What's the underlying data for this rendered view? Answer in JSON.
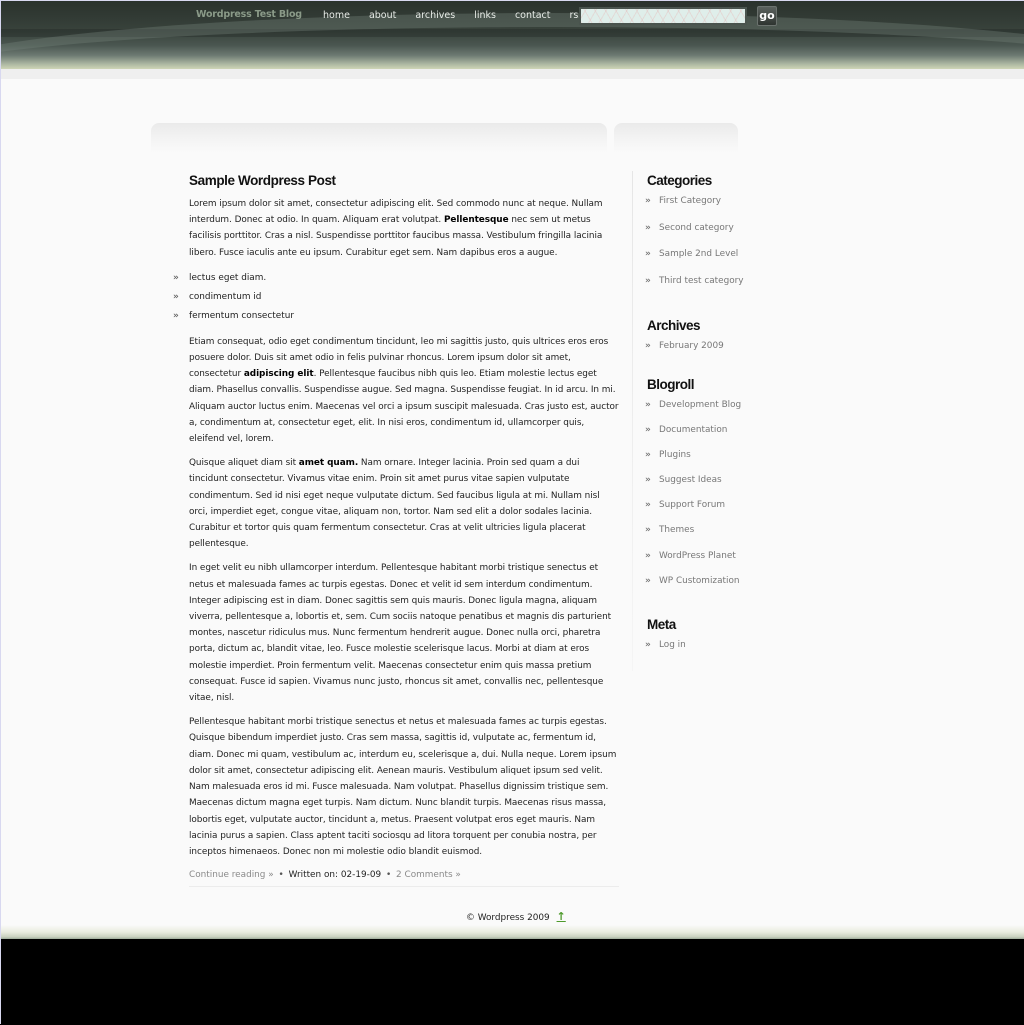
{
  "header": {
    "blog_title": "Wordpress Test Blog",
    "nav": [
      "home",
      "about",
      "archives",
      "links",
      "contact",
      "rss"
    ],
    "search": {
      "value": "",
      "placeholder": ""
    },
    "search_button_label": "go"
  },
  "post": {
    "title": "Sample Wordpress Post",
    "p1": {
      "before_bold": "Lorem ipsum dolor sit amet, consectetur adipiscing elit. Sed commodo nunc at neque. Nullam interdum. Donec at odio. In quam. Aliquam erat volutpat. ",
      "bold": "Pellentesque",
      "after_bold": " nec sem ut metus facilisis porttitor. Cras a nisl. Suspendisse porttitor faucibus massa. Vestibulum fringilla lacinia libero. Fusce iaculis ante eu ipsum. Curabitur eget sem. Nam dapibus eros a augue."
    },
    "list_items": [
      "lectus eget diam.",
      "condimentum id",
      "fermentum consectetur"
    ],
    "list_bullet": "»",
    "p2": {
      "before_bold": "Etiam consequat, odio eget condimentum tincidunt, leo mi sagittis justo, quis ultrices eros eros posuere dolor. Duis sit amet odio in felis pulvinar rhoncus. Lorem ipsum dolor sit amet, consectetur ",
      "bold": "adipiscing elit",
      "after_bold": ". Pellentesque faucibus nibh quis leo. Etiam molestie lectus eget diam. Phasellus convallis. Suspendisse augue. Sed magna. Suspendisse feugiat. In id arcu. In mi. Aliquam auctor luctus enim. Maecenas vel orci a ipsum suscipit malesuada. Cras justo est, auctor a, condimentum at, consectetur eget, elit. In nisi eros, condimentum id, ullamcorper quis, eleifend vel, lorem."
    },
    "p3": {
      "before_bold": "Quisque aliquet diam sit ",
      "bold": "amet quam.",
      "after_bold": " Nam ornare. Integer lacinia. Proin sed quam a dui tincidunt consectetur. Vivamus vitae enim. Proin sit amet purus vitae sapien vulputate condimentum. Sed id nisi eget neque vulputate dictum. Sed faucibus ligula at mi. Nullam nisl orci, imperdiet eget, congue vitae, aliquam non, tortor. Nam sed elit a dolor sodales lacinia. Curabitur et tortor quis quam fermentum consectetur. Cras at velit ultricies ligula placerat pellentesque."
    },
    "p4": "In eget velit eu nibh ullamcorper interdum. Pellentesque habitant morbi tristique senectus et netus et malesuada fames ac turpis egestas. Donec et velit id sem interdum condimentum. Integer adipiscing est in diam. Donec sagittis sem quis mauris. Donec ligula magna, aliquam viverra, pellentesque a, lobortis et, sem. Cum sociis natoque penatibus et magnis dis parturient montes, nascetur ridiculus mus. Nunc fermentum hendrerit augue. Donec nulla orci, pharetra porta, dictum ac, blandit vitae, leo. Fusce molestie scelerisque lacus. Morbi at diam at eros molestie imperdiet. Proin fermentum velit. Maecenas consectetur enim quis massa pretium consequat. Fusce id sapien. Vivamus nunc justo, rhoncus sit amet, convallis nec, pellentesque vitae, nisl.",
    "p5": "Pellentesque habitant morbi tristique senectus et netus et malesuada fames ac turpis egestas. Quisque bibendum imperdiet justo. Cras sem massa, sagittis id, vulputate ac, fermentum id, diam. Donec mi quam, vestibulum ac, interdum eu, scelerisque a, dui. Nulla neque. Lorem ipsum dolor sit amet, consectetur adipiscing elit. Aenean mauris. Vestibulum aliquet ipsum sed velit. Nam malesuada eros id mi. Fusce malesuada. Nam volutpat. Phasellus dignissim tristique sem. Maecenas dictum magna eget turpis. Nam dictum. Nunc blandit turpis. Maecenas risus massa, lobortis eget, vulputate auctor, tincidunt a, metus. Praesent volutpat eros eget mauris. Nam lacinia purus a sapien. Class aptent taciti sociosqu ad litora torquent per conubia nostra, per inceptos himenaeos. Donec non mi molestie odio blandit euismod.",
    "meta": {
      "continue_reading": "Continue reading »",
      "separator": "•",
      "written_on": "Written on: 02-19-09",
      "comments": "2 Comments »"
    }
  },
  "sidebar": {
    "bullet": "»",
    "categories": {
      "title": "Categories",
      "items": [
        "First Category",
        "Second category",
        "Sample 2nd Level",
        "Third test category"
      ]
    },
    "archives": {
      "title": "Archives",
      "items": [
        "February 2009"
      ]
    },
    "blogroll": {
      "title": "Blogroll",
      "items": [
        "Development Blog",
        "Documentation",
        "Plugins",
        "Suggest Ideas",
        "Support Forum",
        "Themes",
        "WordPress Planet",
        "WP Customization"
      ]
    },
    "meta": {
      "title": "Meta",
      "items": [
        "Log in"
      ]
    }
  },
  "footer": {
    "copyright": "© Wordpress 2009",
    "up_icon": "up-arrow-icon"
  },
  "colors": {
    "header_dark": "#2a322c",
    "header_glow": "#cfd5b6",
    "page_bg": "#fafafa",
    "link_gray": "#777777",
    "footer_arrow": "#4e9a2c"
  }
}
